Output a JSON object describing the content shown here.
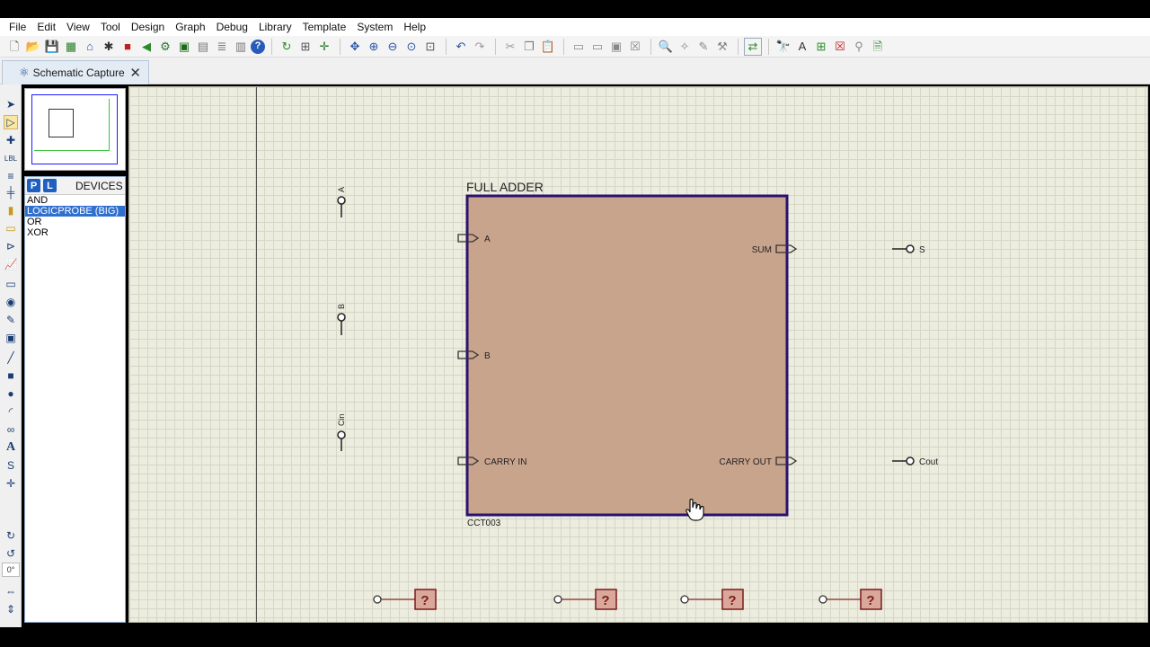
{
  "menubar": {
    "items": [
      "File",
      "Edit",
      "View",
      "Tool",
      "Design",
      "Graph",
      "Debug",
      "Library",
      "Template",
      "System",
      "Help"
    ]
  },
  "toolbar": {
    "groups": [
      [
        "new-icon",
        "open-icon",
        "save-icon",
        "import-icon",
        "home-icon",
        "netlist-icon",
        "stop-icon",
        "back-icon",
        "gear-icon",
        "bom-icon",
        "doc-icon",
        "report-icon",
        "cad-icon",
        "help-icon"
      ],
      [
        "refresh-icon",
        "grid-icon",
        "origin-icon"
      ],
      [
        "pan-icon",
        "zoom-in-icon",
        "zoom-out-icon",
        "zoom-all-icon",
        "zoom-area-icon"
      ],
      [
        "undo-icon",
        "redo-icon"
      ],
      [
        "cut-icon",
        "copy-icon",
        "paste-icon"
      ],
      [
        "block-copy-icon",
        "block-move-icon",
        "block-rotate-icon",
        "block-delete-icon"
      ],
      [
        "pick-icon",
        "make-device-icon",
        "packaging-icon",
        "decompose-icon"
      ],
      [
        "wire-autorouter-icon"
      ],
      [
        "search-icon",
        "property-assign-icon",
        "new-sheet-icon",
        "remove-sheet-icon",
        "exit-parent-icon",
        "design-explorer-icon"
      ]
    ]
  },
  "tab": {
    "label": "Schematic Capture",
    "icon": "schematic-icon"
  },
  "devices": {
    "p_label": "P",
    "l_label": "L",
    "title": "DEVICES",
    "items": [
      "AND",
      "LOGICPROBE (BIG)",
      "OR",
      "XOR"
    ],
    "selected_index": 1
  },
  "left_tools": {
    "rotation_label": "0°"
  },
  "schematic": {
    "block_title": "FULL ADDER",
    "block_ref": "CCT003",
    "block_fill": "#c9a48d",
    "block_border": "#2a1270",
    "inputs_left": [
      "A",
      "B",
      "CARRY IN"
    ],
    "outputs_right": [
      "SUM",
      "CARRY OUT"
    ],
    "terminals_left": [
      "A",
      "B",
      "Cin"
    ],
    "terminals_right": [
      "S",
      "Cout"
    ],
    "probe_label": "?",
    "probe_count": 4
  }
}
